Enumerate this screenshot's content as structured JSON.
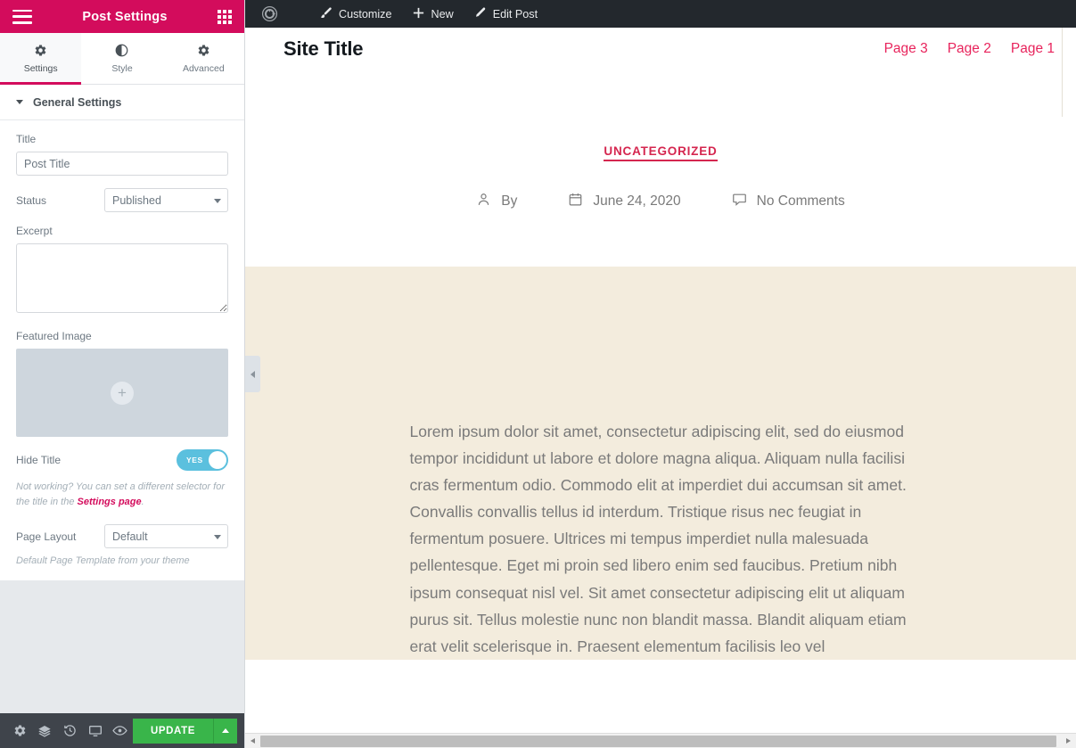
{
  "panel": {
    "header": {
      "title": "Post Settings",
      "menu_icon": "hamburger-icon",
      "grid_icon": "grid-icon"
    },
    "tabs": [
      {
        "label": "Settings",
        "icon": "gear-icon",
        "active": true
      },
      {
        "label": "Style",
        "icon": "contrast-icon",
        "active": false
      },
      {
        "label": "Advanced",
        "icon": "gear-icon",
        "active": false
      }
    ],
    "section": {
      "title": "General Settings"
    },
    "fields": {
      "title_label": "Title",
      "title_value": "Post Title",
      "title_placeholder": "Post Title",
      "status_label": "Status",
      "status_value": "Published",
      "status_options": [
        "Published"
      ],
      "excerpt_label": "Excerpt",
      "excerpt_value": "",
      "featured_image_label": "Featured Image",
      "featured_image_add": "+",
      "hide_title_label": "Hide Title",
      "hide_title_value": "YES",
      "hide_title_help_before": "Not working? You can set a different selector for the title in the ",
      "hide_title_help_link": "Settings page",
      "hide_title_help_after": ".",
      "page_layout_label": "Page Layout",
      "page_layout_value": "Default",
      "page_layout_options": [
        "Default"
      ],
      "page_layout_note": "Default Page Template from your theme"
    },
    "footer": {
      "icons": [
        "gear-icon",
        "layers-icon",
        "history-icon",
        "responsive-icon",
        "preview-eye-icon"
      ],
      "update_label": "UPDATE",
      "update_caret": "caret-up-icon"
    }
  },
  "adminbar": {
    "wp_icon": "wordpress-logo-icon",
    "items": [
      {
        "label": "Customize",
        "icon": "paintbrush-icon"
      },
      {
        "label": "New",
        "icon": "plus-icon"
      },
      {
        "label": "Edit Post",
        "icon": "pencil-icon"
      }
    ]
  },
  "site": {
    "title": "Site Title",
    "nav": [
      {
        "label": "Page 3"
      },
      {
        "label": "Page 2"
      },
      {
        "label": "Page 1"
      }
    ]
  },
  "post": {
    "category": "UNCATEGORIZED",
    "meta": [
      {
        "icon": "person-icon",
        "label": "By"
      },
      {
        "icon": "calendar-icon",
        "label": "June 24, 2020"
      },
      {
        "icon": "comment-icon",
        "label": "No Comments"
      }
    ],
    "body": "Lorem ipsum dolor sit amet, consectetur adipiscing elit, sed do eiusmod tempor incididunt ut labore et dolore magna aliqua. Aliquam nulla facilisi cras fermentum odio. Commodo elit at imperdiet dui accumsan sit amet. Convallis convallis tellus id interdum. Tristique risus nec feugiat in fermentum posuere. Ultrices mi tempus imperdiet nulla malesuada pellentesque. Eget mi proin sed libero enim sed faucibus. Pretium nibh ipsum consequat nisl vel. Sit amet consectetur adipiscing elit ut aliquam purus sit. Tellus molestie nunc non blandit massa. Blandit aliquam etiam erat velit scelerisque in. Praesent elementum facilisis leo vel"
  },
  "colors": {
    "brand_pink": "#d30c5c",
    "nav_pink": "#e8245c",
    "category_pink": "#d5264f",
    "toggle_blue": "#5bc0de",
    "update_green": "#39b54a",
    "adminbar_dark": "#23282d",
    "panel_footer_dark": "#3f444b",
    "body_cream": "#f3ecdd"
  }
}
